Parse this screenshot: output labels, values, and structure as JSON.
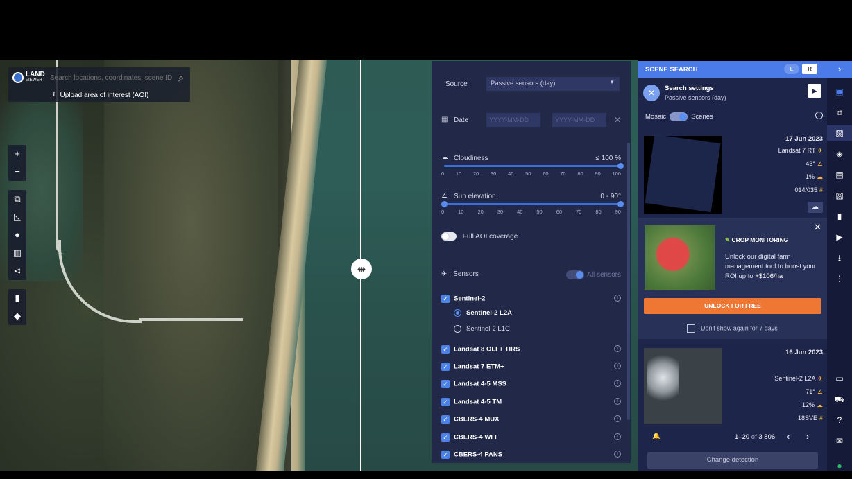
{
  "search": {
    "placeholder": "Search locations, coordinates, scene IDs",
    "aoi_label": "Upload area of interest (AOI)",
    "logo_line1": "LAND",
    "logo_line2": "VIEWER"
  },
  "filters": {
    "source_label": "Source",
    "source_value": "Passive sensors (day)",
    "date_label": "Date",
    "date_from_placeholder": "YYYY-MM-DD",
    "date_to_placeholder": "YYYY-MM-DD",
    "cloudiness_label": "Cloudiness",
    "cloudiness_value": "≤ 100 %",
    "cloudiness_ticks": [
      "0",
      "10",
      "20",
      "30",
      "40",
      "50",
      "60",
      "70",
      "80",
      "90",
      "100"
    ],
    "sun_label": "Sun elevation",
    "sun_value": "0 - 90°",
    "sun_ticks": [
      "0",
      "10",
      "20",
      "30",
      "40",
      "50",
      "60",
      "70",
      "80",
      "90"
    ],
    "full_aoi_label": "Full AOI coverage",
    "sensors_label": "Sensors",
    "all_sensors_label": "All sensors",
    "sensors": [
      "Sentinel-2",
      "Landsat 8 OLI + TIRS",
      "Landsat 7 ETM+",
      "Landsat 4-5 MSS",
      "Landsat 4-5 TM",
      "CBERS-4 MUX",
      "CBERS-4 WFI",
      "CBERS-4 PANS"
    ],
    "sentinel_options": [
      "Sentinel-2 L2A",
      "Sentinel-2 L1C"
    ]
  },
  "scene_panel": {
    "title": "SCENE SEARCH",
    "left_btn": "L",
    "right_btn": "R",
    "settings_title": "Search settings",
    "settings_sub": "Passive sensors (day)",
    "mosaic_label": "Mosaic",
    "scenes_label": "Scenes",
    "scenes": [
      {
        "date": "17 Jun 2023",
        "sensor": "Landsat  7  RT",
        "angle": "43°",
        "cloud": "1%",
        "grid": "014/035"
      },
      {
        "date": "16 Jun 2023",
        "sensor": "Sentinel-2  L2A",
        "angle": "71°",
        "cloud": "12%",
        "grid": "18SVE"
      }
    ],
    "ad": {
      "title": "CROP MONITORING",
      "text": "Unlock our digital farm management tool to boost your ROI up to",
      "highlight": "+$106/ha",
      "button": "UNLOCK FOR FREE",
      "dont_show": "Don't show again for 7 days"
    },
    "pager": {
      "range": "1–20",
      "of": "of",
      "total": "3 806"
    },
    "change_detection": "Change detection"
  },
  "colors": {
    "accent": "#4a7be8",
    "panel": "#212848",
    "orange": "#ee7733"
  }
}
